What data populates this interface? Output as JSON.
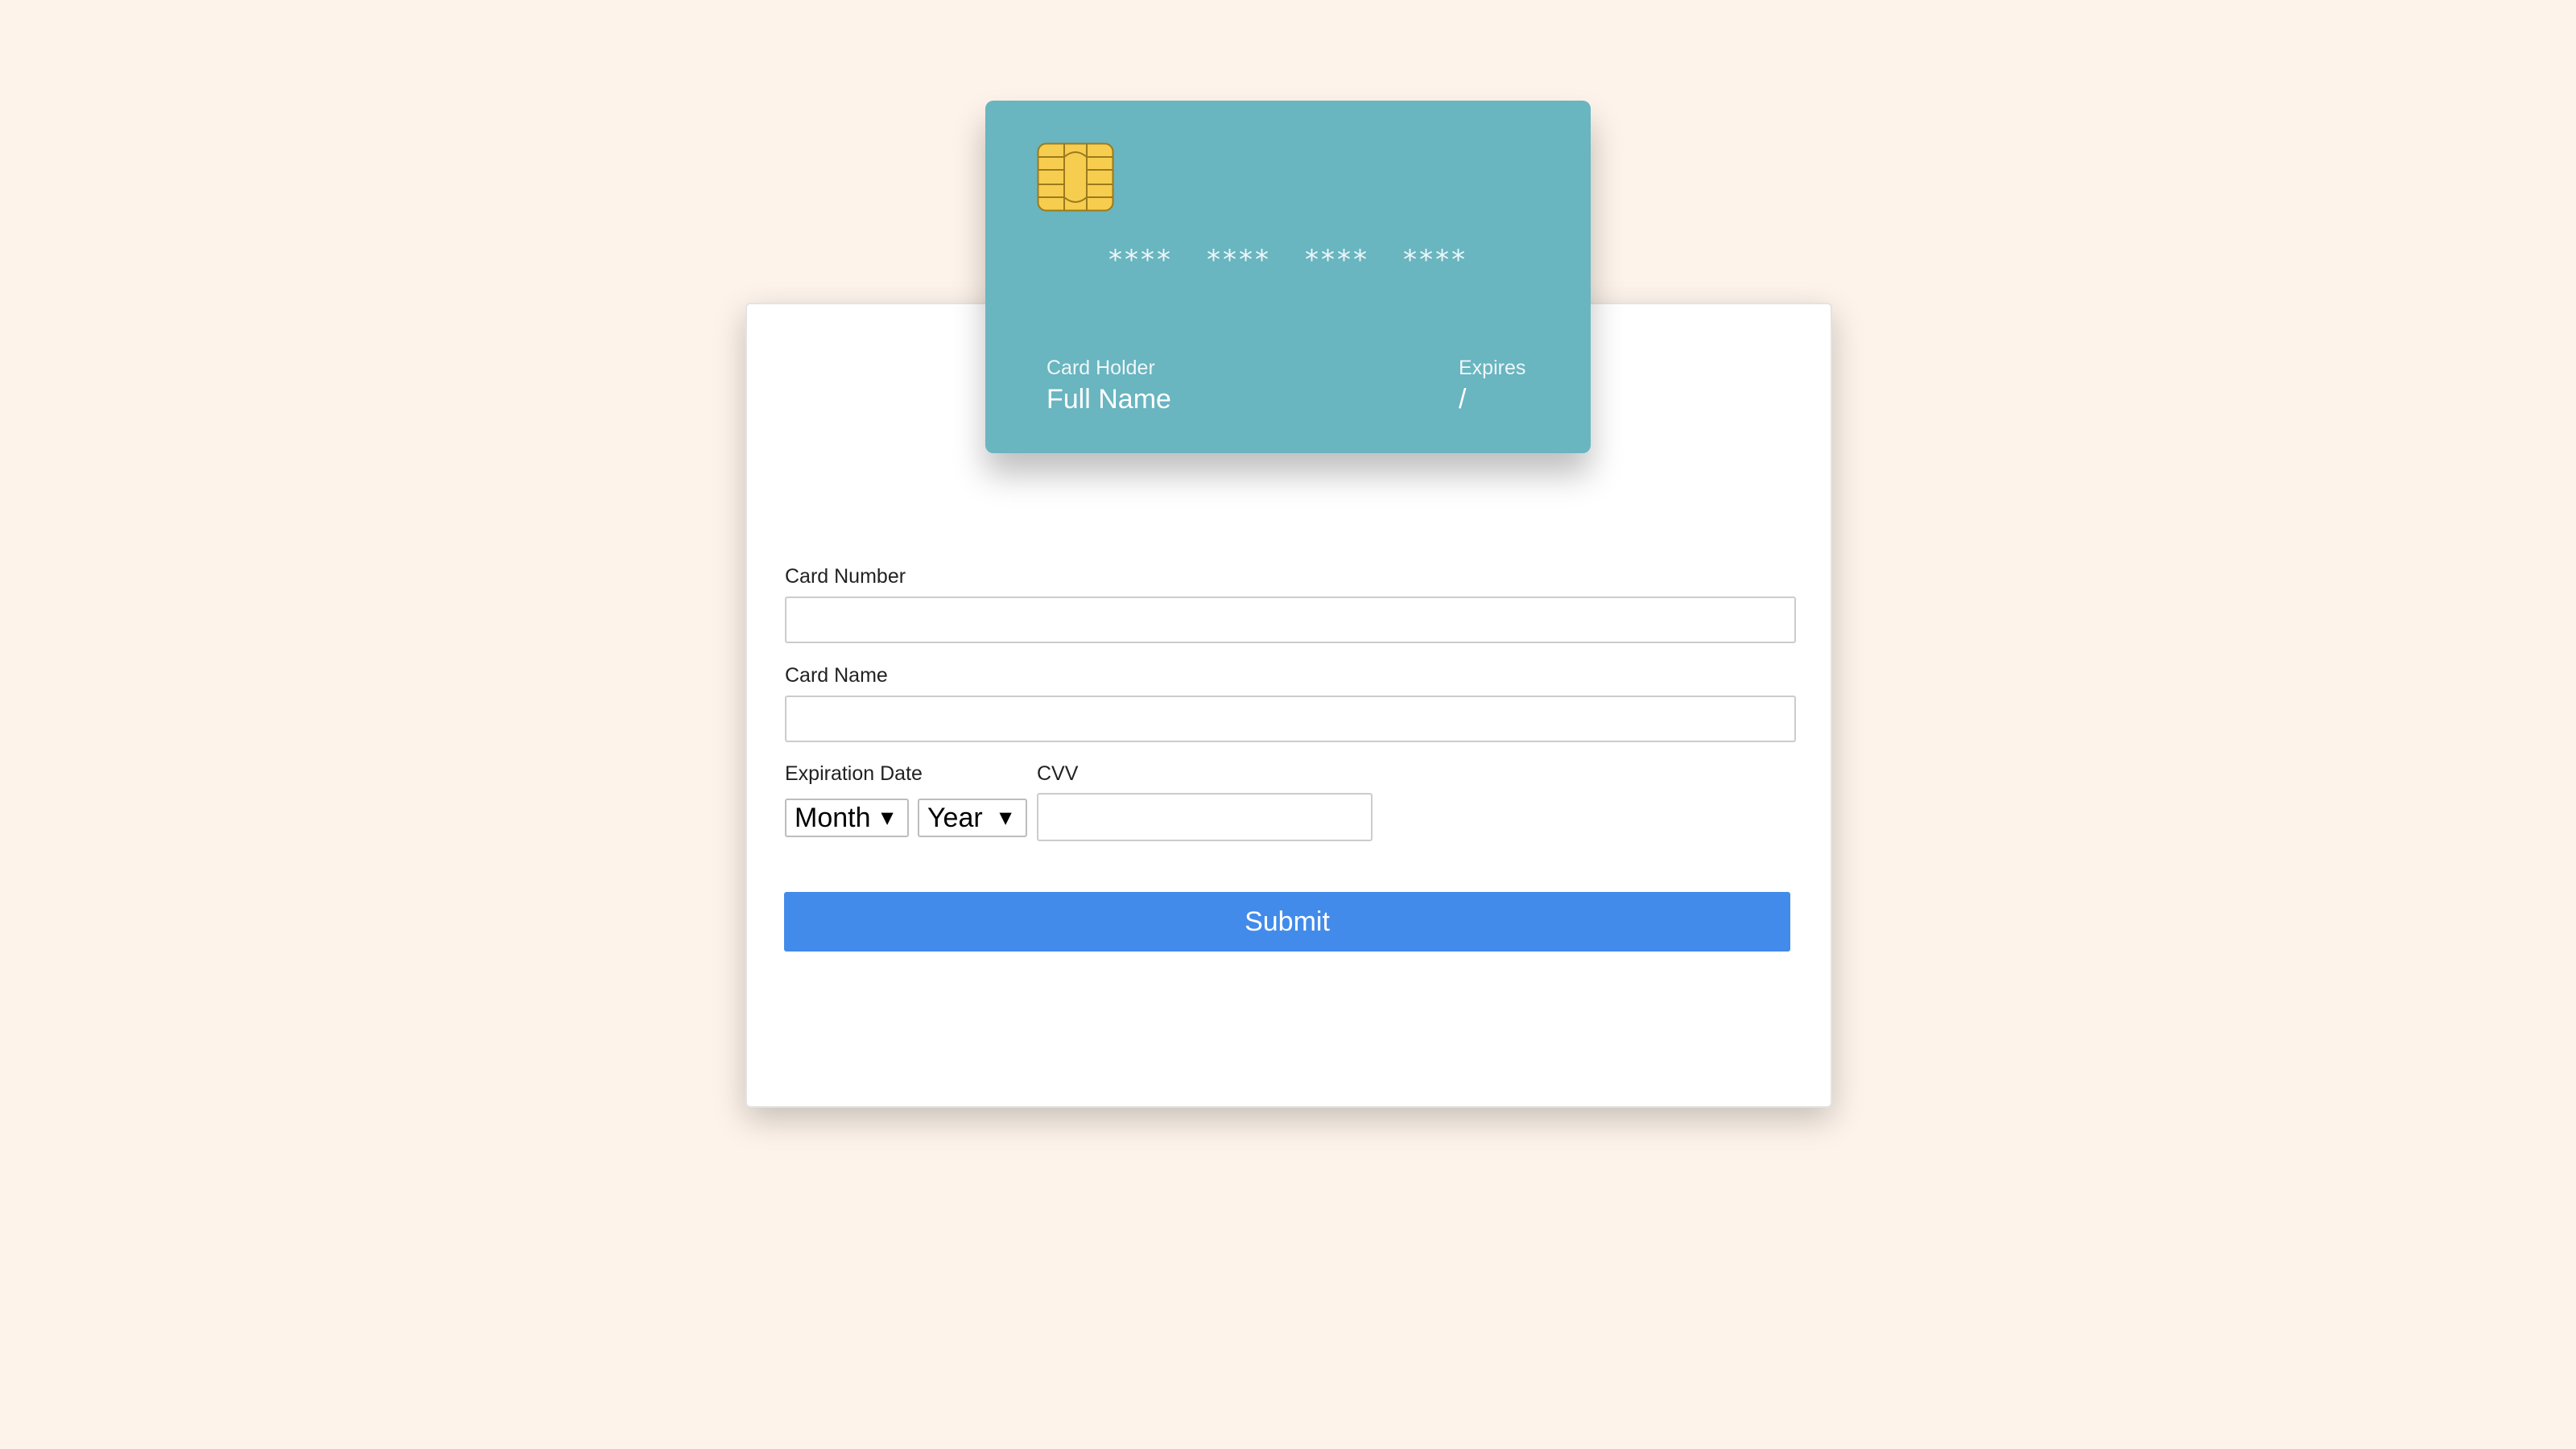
{
  "card_preview": {
    "number_groups": [
      "****",
      "****",
      "****",
      "****"
    ],
    "holder_label": "Card Holder",
    "holder_value": "Full Name",
    "expires_label": "Expires",
    "expires_value": "/",
    "color": "#69b5c0"
  },
  "form": {
    "card_number": {
      "label": "Card Number",
      "value": ""
    },
    "card_name": {
      "label": "Card Name",
      "value": ""
    },
    "expiration": {
      "label": "Expiration Date",
      "month": "Month",
      "year": "Year"
    },
    "cvv": {
      "label": "CVV",
      "value": ""
    },
    "submit_label": "Submit"
  },
  "icons": {
    "chip": "card-chip-icon",
    "caret": "▼"
  },
  "colors": {
    "background": "#fdf3ea",
    "submit": "#428bea",
    "chip": "#f2c94c"
  }
}
